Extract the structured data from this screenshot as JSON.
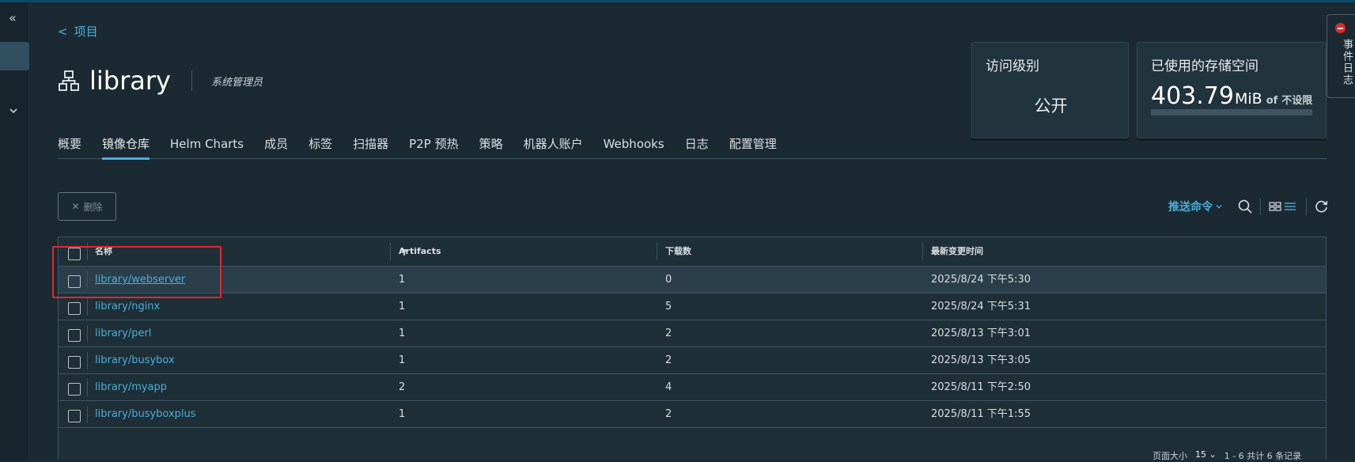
{
  "nav": {
    "back_label": "项目"
  },
  "project": {
    "name": "library",
    "role": "系统管理员"
  },
  "cards": {
    "access": {
      "label": "访问级别",
      "value": "公开"
    },
    "storage": {
      "label": "已使用的存储空间",
      "used": "403.79",
      "unit": "MiB",
      "of": "of",
      "limit": "不设限",
      "usage_fraction": 0
    }
  },
  "event_log": {
    "label": "事件日志"
  },
  "tabs": [
    {
      "label": "概要"
    },
    {
      "label": "镜像仓库",
      "active": true
    },
    {
      "label": "Helm Charts"
    },
    {
      "label": "成员"
    },
    {
      "label": "标签"
    },
    {
      "label": "扫描器"
    },
    {
      "label": "P2P 预热"
    },
    {
      "label": "策略"
    },
    {
      "label": "机器人账户"
    },
    {
      "label": "Webhooks"
    },
    {
      "label": "日志"
    },
    {
      "label": "配置管理"
    }
  ],
  "actions": {
    "delete_label": "删除",
    "push_command_label": "推送命令"
  },
  "table": {
    "headers": {
      "name": "名称",
      "artifacts": "Artifacts",
      "pulls": "下载数",
      "updated": "最新变更时间"
    },
    "rows": [
      {
        "name": "library/webserver",
        "artifacts": "1",
        "pulls": "0",
        "updated": "2025/8/24 下午5:30"
      },
      {
        "name": "library/nginx",
        "artifacts": "1",
        "pulls": "5",
        "updated": "2025/8/24 下午5:31"
      },
      {
        "name": "library/perl",
        "artifacts": "1",
        "pulls": "2",
        "updated": "2025/8/13 下午3:01"
      },
      {
        "name": "library/busybox",
        "artifacts": "1",
        "pulls": "2",
        "updated": "2025/8/13 下午3:05"
      },
      {
        "name": "library/myapp",
        "artifacts": "2",
        "pulls": "4",
        "updated": "2025/8/11 下午2:50"
      },
      {
        "name": "library/busyboxplus",
        "artifacts": "1",
        "pulls": "2",
        "updated": "2025/8/11 下午1:55"
      }
    ]
  },
  "footer": {
    "page_size_label": "页面大小",
    "page_size": "15",
    "summary": "1 - 6 共计 6 条记录"
  },
  "colors": {
    "accent": "#4aaed9",
    "highlight_box": "#e02831",
    "background": "#1b2a32"
  },
  "icons": [
    "collapse-icon",
    "project-icon",
    "search-icon",
    "card-view-icon",
    "list-view-icon",
    "refresh-icon",
    "filter-icon",
    "close-icon",
    "chevron-down-icon"
  ]
}
